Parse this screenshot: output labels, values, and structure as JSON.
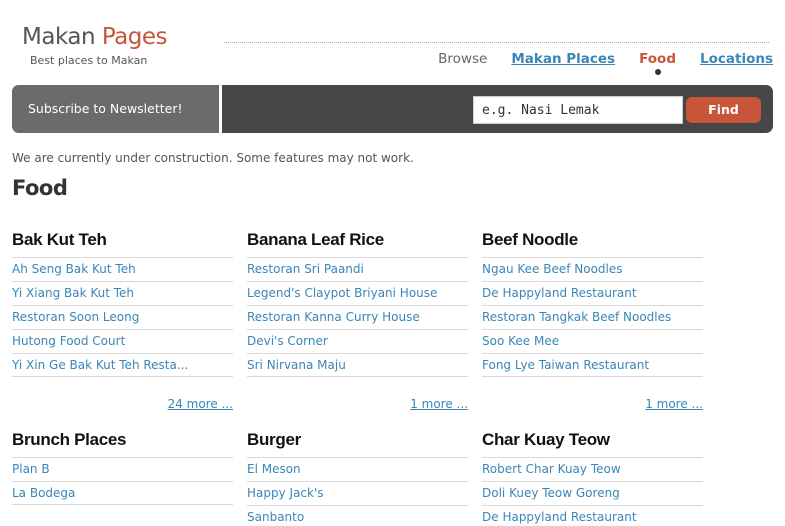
{
  "header": {
    "logo_part1": "Makan",
    "logo_part2": "Pages",
    "tagline": "Best places to Makan"
  },
  "nav": {
    "browse": "Browse",
    "makan_places": "Makan Places",
    "food": "Food",
    "locations": "Locations"
  },
  "bar": {
    "subscribe_label": "Subscribe to Newsletter!",
    "search_value": "e.g. Nasi Lemak",
    "find_label": "Find"
  },
  "notice": "We are currently under construction. Some features may not work.",
  "page_title": "Food",
  "categories": [
    {
      "title": "Bak Kut Teh",
      "items": [
        "Ah Seng Bak Kut Teh",
        "Yi Xiang Bak Kut Teh",
        "Restoran Soon Leong",
        "Hutong Food Court",
        "Yi Xin Ge Bak Kut Teh Resta..."
      ],
      "more": "24 more ..."
    },
    {
      "title": "Banana Leaf Rice",
      "items": [
        "Restoran Sri Paandi",
        "Legend's Claypot Briyani House",
        "Restoran Kanna Curry House",
        "Devi's Corner",
        "Sri Nirvana Maju"
      ],
      "more": "1 more ..."
    },
    {
      "title": "Beef Noodle",
      "items": [
        "Ngau Kee Beef Noodles",
        "De Happyland Restaurant",
        "Restoran Tangkak Beef Noodles",
        "Soo Kee Mee",
        "Fong Lye Taiwan Restaurant"
      ],
      "more": "1 more ..."
    },
    {
      "title": "Brunch Places",
      "items": [
        "Plan B",
        "La Bodega"
      ]
    },
    {
      "title": "Burger",
      "items": [
        "El Meson",
        "Happy Jack's",
        "Sanbanto"
      ]
    },
    {
      "title": "Char Kuay Teow",
      "items": [
        "Robert Char Kuay Teow",
        "Doli Kuey Teow Goreng",
        "De Happyland Restaurant"
      ]
    }
  ]
}
